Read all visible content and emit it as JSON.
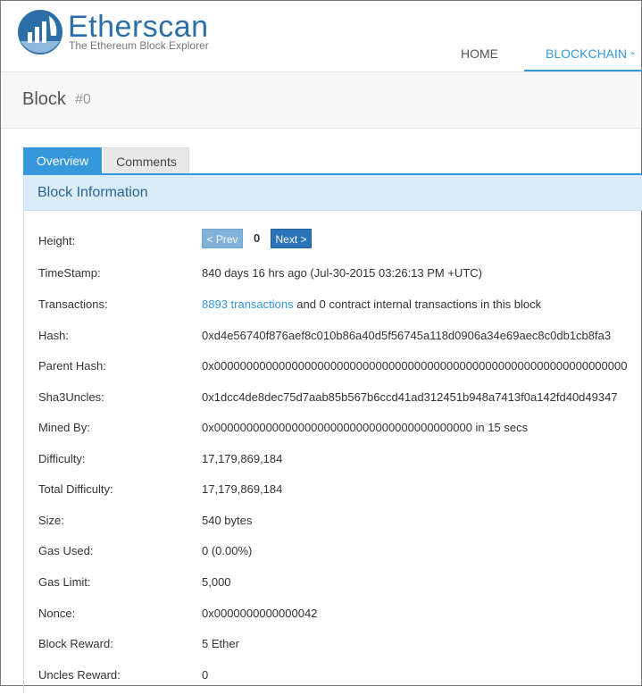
{
  "header": {
    "brand": "Etherscan",
    "tagline": "The Ethereum Block Explorer",
    "nav": {
      "home": "HOME",
      "blockchain": "BLOCKCHAIN",
      "chevron": "⌄"
    },
    "accent_color": "#3498db"
  },
  "page": {
    "title": "Block",
    "block_number": "#0"
  },
  "tabs": {
    "overview": "Overview",
    "comments": "Comments"
  },
  "panel": {
    "title": "Block Information"
  },
  "fields": {
    "height": {
      "label": "Height:",
      "prev": "< Prev",
      "value": "0",
      "next": "Next >"
    },
    "timestamp": {
      "label": "TimeStamp:",
      "value": "840 days 16 hrs ago (Jul-30-2015 03:26:13 PM +UTC)"
    },
    "transactions": {
      "label": "Transactions:",
      "link": "8893 transactions",
      "rest": " and 0 contract internal transactions in this block"
    },
    "hash": {
      "label": "Hash:",
      "value": "0xd4e56740f876aef8c010b86a40d5f56745a118d0906a34e69aec8c0db1cb8fa3"
    },
    "parent_hash": {
      "label": "Parent Hash:",
      "value": "0x0000000000000000000000000000000000000000000000000000000000000000"
    },
    "sha3uncles": {
      "label": "Sha3Uncles:",
      "value": "0x1dcc4de8dec75d7aab85b567b6ccd41ad312451b948a7413f0a142fd40d49347"
    },
    "mined_by": {
      "label": "Mined By:",
      "value": "0x0000000000000000000000000000000000000000 in 15 secs"
    },
    "difficulty": {
      "label": "Difficulty:",
      "value": "17,179,869,184"
    },
    "total_difficulty": {
      "label": "Total Difficulty:",
      "value": "17,179,869,184"
    },
    "size": {
      "label": "Size:",
      "value": "540 bytes"
    },
    "gas_used": {
      "label": "Gas Used:",
      "value": "0 (0.00%)"
    },
    "gas_limit": {
      "label": "Gas Limit:",
      "value": "5,000"
    },
    "nonce": {
      "label": "Nonce:",
      "value": "0x0000000000000042"
    },
    "block_reward": {
      "label": "Block Reward:",
      "value": "5 Ether"
    },
    "uncles_reward": {
      "label": "Uncles Reward:",
      "value": "0"
    }
  }
}
